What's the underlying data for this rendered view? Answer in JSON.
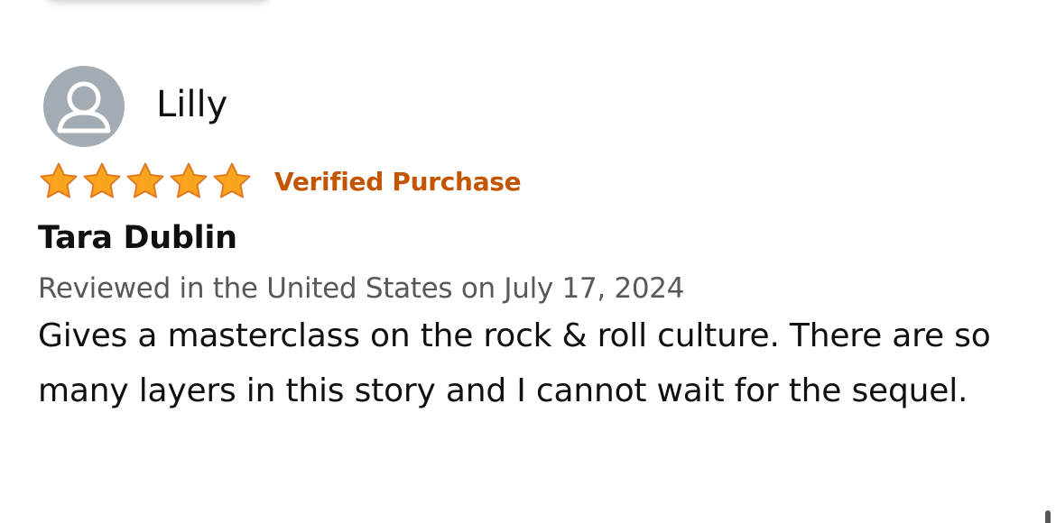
{
  "review": {
    "reviewer_name": "Lilly",
    "avatar_icon": "user-silhouette-icon",
    "rating": 5,
    "rating_max": 5,
    "star_color": "#f8a41c",
    "verified_label": "Verified Purchase",
    "verified_color": "#c45500",
    "title": "Tara Dublin",
    "meta": "Reviewed in the United States on July 17, 2024",
    "body": "Gives a masterclass on the rock & roll culture. There are so many layers in this story and I cannot wait for the sequel."
  }
}
